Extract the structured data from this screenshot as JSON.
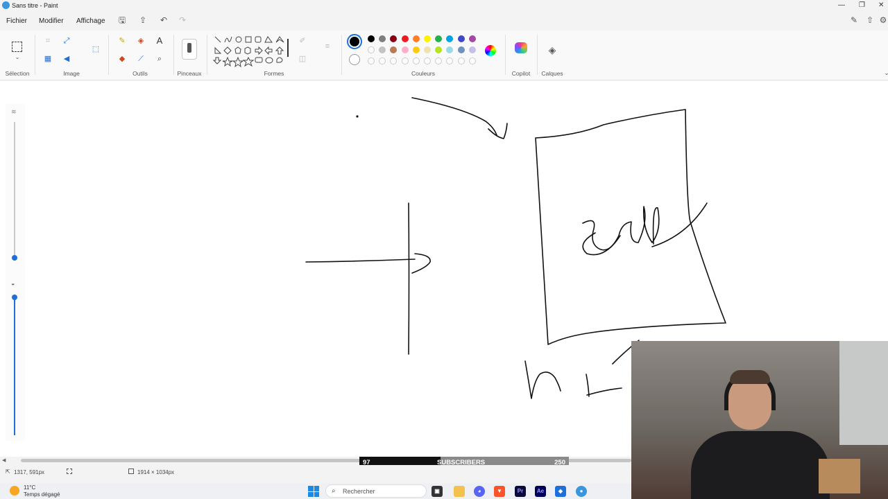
{
  "window": {
    "title": "Sans titre - Paint"
  },
  "menu": {
    "file": "Fichier",
    "edit": "Modifier",
    "view": "Affichage"
  },
  "ribbon": {
    "selection": "Sélection",
    "image": "Image",
    "tools": "Outils",
    "brushes": "Pinceaux",
    "shapes": "Formes",
    "colors": "Couleurs",
    "copilot": "Copilot",
    "layers": "Calques"
  },
  "palette": {
    "row1": [
      "#000000",
      "#7f7f7f",
      "#880015",
      "#ed1c24",
      "#ff7f27",
      "#fff200",
      "#22b14c",
      "#00a2e8",
      "#3f48cc",
      "#a349a4"
    ],
    "row2": [
      "#ffffff",
      "#c3c3c3",
      "#b97a57",
      "#ffaec9",
      "#ffc90e",
      "#efe4b0",
      "#b5e61d",
      "#99d9ea",
      "#7092be",
      "#c8bfe7"
    ]
  },
  "status": {
    "cursor": "1317, 591px",
    "canvas_size": "1914 × 1034px"
  },
  "overlay": {
    "sub_current": "97",
    "sub_label": "SUBSCRIBERS",
    "sub_goal": "250",
    "sub_progress": 0.388
  },
  "taskbar": {
    "weather_temp": "11°C",
    "weather_text": "Temps dégagé",
    "search_placeholder": "Rechercher"
  }
}
